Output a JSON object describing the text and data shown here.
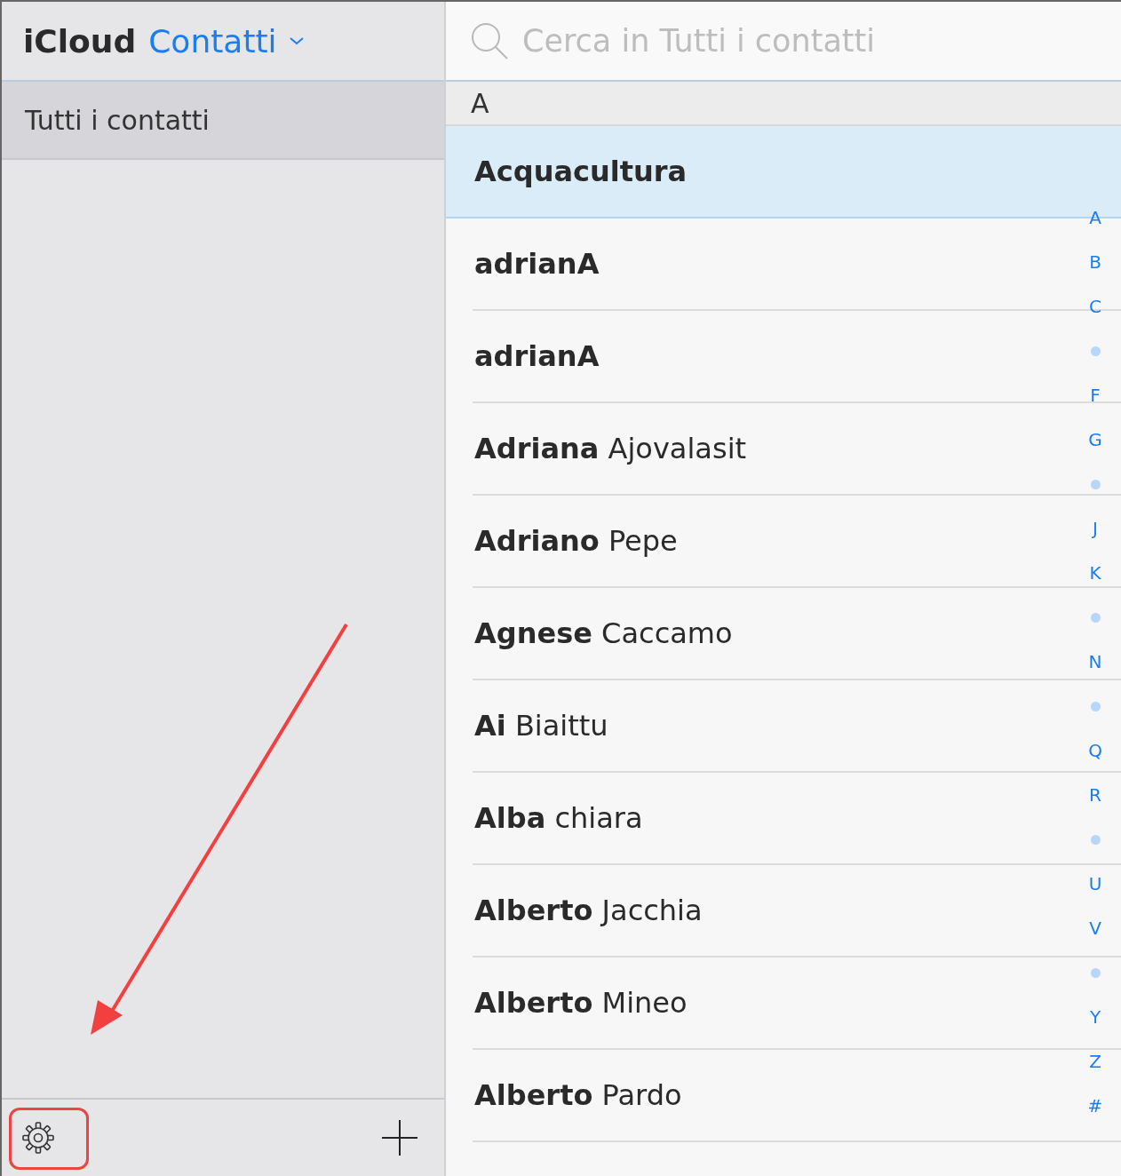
{
  "sidebar": {
    "brand": "iCloud",
    "app_menu": "Contatti",
    "groups": [
      {
        "label": "Tutti i contatti",
        "selected": true
      }
    ]
  },
  "search": {
    "placeholder": "Cerca in Tutti i contatti"
  },
  "section": "A",
  "contacts": [
    {
      "first": "Acquacultura",
      "selected": true
    },
    {
      "first": "adrianA",
      "selected": false
    },
    {
      "first": "adrianA",
      "selected": false
    },
    {
      "first": "Adriana",
      "last": "Ajovalasit",
      "selected": false
    },
    {
      "first": "Adriano",
      "last": "Pepe",
      "selected": false
    },
    {
      "first": "Agnese",
      "last": "Caccamo",
      "selected": false
    },
    {
      "first": "Ai",
      "last": "Biaittu",
      "selected": false
    },
    {
      "first": "Alba",
      "last": "chiara",
      "selected": false
    },
    {
      "first": "Alberto",
      "last": "Jacchia",
      "selected": false
    },
    {
      "first": "Alberto",
      "last": "Mineo",
      "selected": false
    },
    {
      "first": "Alberto",
      "last": "Pardo",
      "selected": false
    }
  ],
  "index": [
    {
      "kind": "letter",
      "text": "A"
    },
    {
      "kind": "letter",
      "text": "B"
    },
    {
      "kind": "letter",
      "text": "C"
    },
    {
      "kind": "dot"
    },
    {
      "kind": "letter",
      "text": "F"
    },
    {
      "kind": "letter",
      "text": "G"
    },
    {
      "kind": "dot"
    },
    {
      "kind": "letter",
      "text": "J"
    },
    {
      "kind": "letter",
      "text": "K"
    },
    {
      "kind": "dot"
    },
    {
      "kind": "letter",
      "text": "N"
    },
    {
      "kind": "dot"
    },
    {
      "kind": "letter",
      "text": "Q"
    },
    {
      "kind": "letter",
      "text": "R"
    },
    {
      "kind": "dot"
    },
    {
      "kind": "letter",
      "text": "U"
    },
    {
      "kind": "letter",
      "text": "V"
    },
    {
      "kind": "dot"
    },
    {
      "kind": "letter",
      "text": "Y"
    },
    {
      "kind": "letter",
      "text": "Z"
    },
    {
      "kind": "letter",
      "text": "#"
    }
  ],
  "annotations": {
    "arrow": true,
    "highlight_box": true
  }
}
